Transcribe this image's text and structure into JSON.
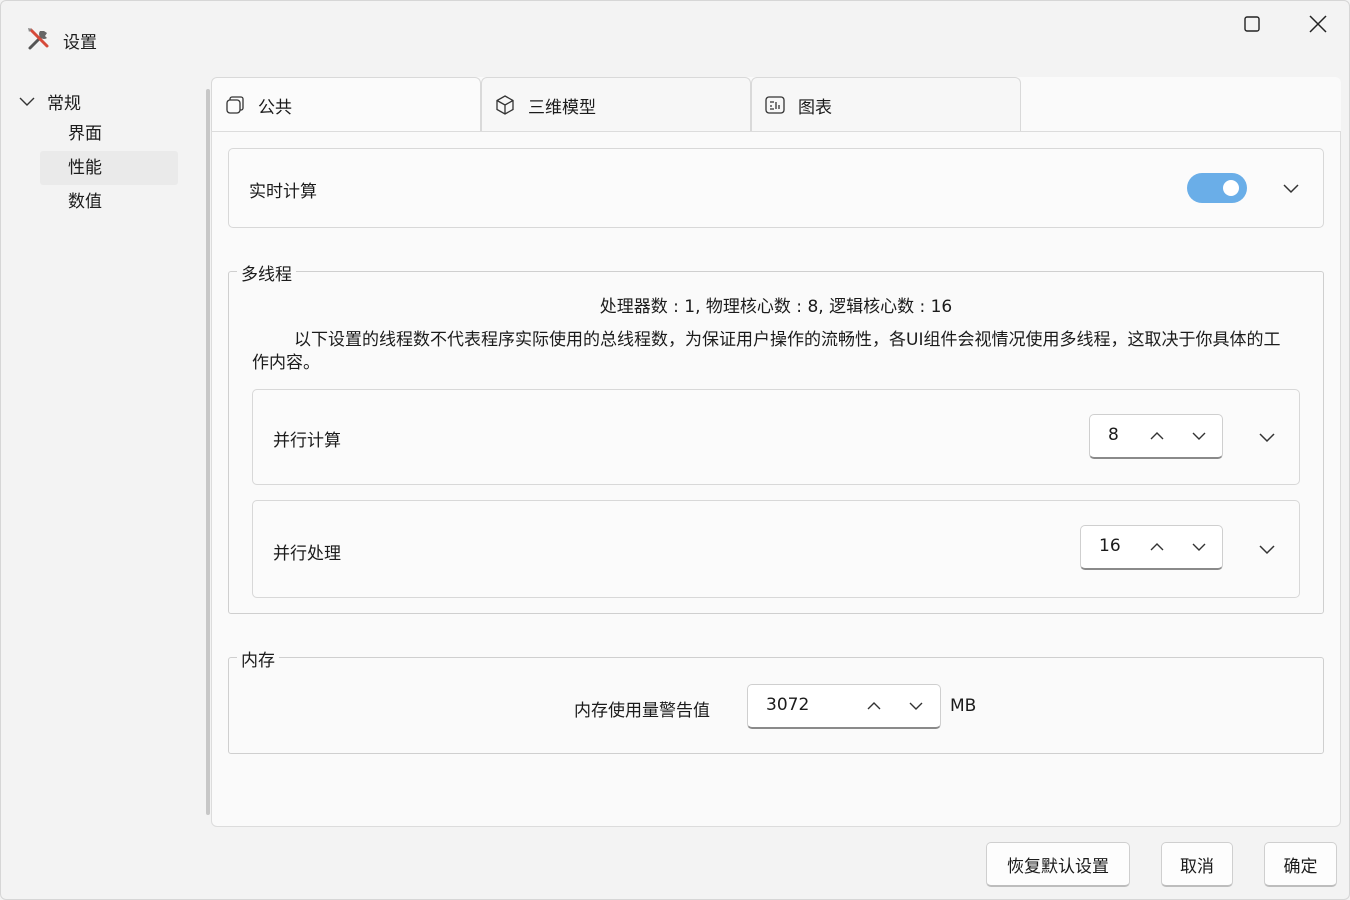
{
  "window": {
    "title": "设置"
  },
  "sidebar": {
    "root": "常规",
    "items": [
      {
        "label": "界面",
        "selected": false
      },
      {
        "label": "性能",
        "selected": true
      },
      {
        "label": "数值",
        "selected": false
      }
    ]
  },
  "tabs": [
    {
      "label": "公共",
      "icon": "cube-outline-icon"
    },
    {
      "label": "三维模型",
      "icon": "box-3d-icon"
    },
    {
      "label": "图表",
      "icon": "chart-icon"
    }
  ],
  "realtime": {
    "label": "实时计算",
    "enabled": true
  },
  "multithread": {
    "title": "多线程",
    "cpu_info": "处理器数 : 1,  物理核心数 : 8,  逻辑核心数 : 16",
    "note": "以下设置的线程数不代表程序实际使用的总线程数，为保证用户操作的流畅性，各UI组件会视情况使用多线程，这取决于你具体的工作内容。",
    "parallel_compute": {
      "label": "并行计算",
      "value": "8"
    },
    "parallel_process": {
      "label": "并行处理",
      "value": "16"
    }
  },
  "memory": {
    "title": "内存",
    "label": "内存使用量警告值",
    "value": "3072",
    "unit": "MB"
  },
  "footer": {
    "reset": "恢复默认设置",
    "cancel": "取消",
    "ok": "确定"
  },
  "colors": {
    "accent": "#6aaee8"
  }
}
